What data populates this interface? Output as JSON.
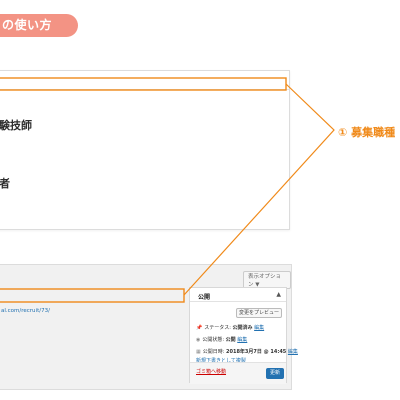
{
  "section": {
    "title": "の使い方"
  },
  "editor": {
    "line1": "験技師",
    "line2": "者"
  },
  "admin": {
    "permalink": "al.com/recruit/73/",
    "screen_options": "表示オプション ▼",
    "publish_box": {
      "title": "公開",
      "toggle_arrow": "▲",
      "preview_label": "変更をプレビュー",
      "status_label": "ステータス:",
      "status_value": "公開済み",
      "status_edit": "編集",
      "visibility_label": "公開状態:",
      "visibility_value": "公開",
      "visibility_edit": "編集",
      "date_label": "公開日時:",
      "date_value": "2018年3月7日 @ 14:45",
      "date_edit": "編集",
      "draft_link": "新規下書きとして複製",
      "trash_link": "ゴミ箱へ移動",
      "update_label": "更新"
    }
  },
  "annotation": {
    "label": "① 募集職種",
    "color": "#f08a1a"
  },
  "colors": {
    "pill": "#f39384",
    "link": "#2271b1",
    "delete": "#cc0000",
    "primary_button": "#2271b1",
    "callout": "#f08a1a"
  }
}
